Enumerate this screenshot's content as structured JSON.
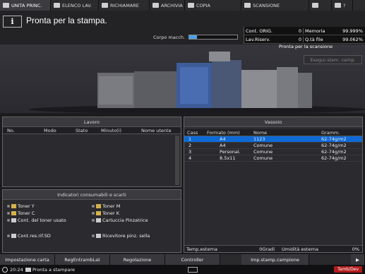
{
  "tabs": [
    {
      "label": "UNITA PRINC.",
      "icon": "home-icon"
    },
    {
      "label": "ELENCO LAV.",
      "icon": "job-list-icon"
    },
    {
      "label": "RICHIAMARE",
      "icon": "recall-icon"
    },
    {
      "label": "ARCHIVIA",
      "icon": "store-icon"
    },
    {
      "label": "COPIA",
      "icon": "copy-icon"
    },
    {
      "label": "SCANSIONE",
      "icon": "scan-icon"
    },
    {
      "label": "",
      "icon": "web-icon"
    },
    {
      "label": "?",
      "icon": "help-icon"
    }
  ],
  "header": {
    "info_glyph": "i",
    "status_message": "Pronta per la stampa.",
    "corpo_label": "Corpo macch.",
    "corpo_level": 0.15
  },
  "counters": {
    "cont_orig_label": "Cont. ORIG.",
    "cont_orig_value": "0",
    "memoria_label": "Memoria",
    "memoria_value": "99.999%",
    "lav_riserv_label": "Lav.Riserv.",
    "lav_riserv_value": "0",
    "qta_file_label": "Q.tà file",
    "qta_file_value": "99.062%"
  },
  "scan": {
    "status": "Pronta per la scansione",
    "button": "Esegui stam. camp."
  },
  "lavoro": {
    "title": "Lavoro",
    "columns": [
      "No.",
      "Modo",
      "Stato",
      "Minuto(i)",
      "Nome utente"
    ]
  },
  "consumabili": {
    "title": "Indicatori consumabili e scarti",
    "items": [
      {
        "label": "Toner Y",
        "color": "#d6b24a"
      },
      {
        "label": "Toner M",
        "color": "#d6b24a"
      },
      {
        "label": "Toner C",
        "color": "#d6b24a"
      },
      {
        "label": "Toner K",
        "color": "#d6b24a"
      },
      {
        "label": "Cont. del toner usato",
        "color": "#cccccc"
      },
      {
        "label": "Cartuccia Pinzatrice",
        "color": "#cccccc"
      },
      {
        "label": "Cont.res.rif.SD",
        "color": "#cccccc"
      },
      {
        "label": "Ricevitore pinz. sella",
        "color": "#cccccc"
      }
    ]
  },
  "vassoio": {
    "title": "Vassoio",
    "columns": [
      "Cass",
      "Formato (mm)",
      "Nome",
      "Gramm."
    ],
    "rows": [
      {
        "cass": "1",
        "formato": "A4",
        "nome": "1123",
        "gramm": "62-74g/m2",
        "selected": true
      },
      {
        "cass": "2",
        "formato": "A4",
        "nome": "Comune",
        "gramm": "62-74g/m2",
        "selected": false
      },
      {
        "cass": "3",
        "formato": "Personal.",
        "nome": "Comune",
        "gramm": "62-74g/m2",
        "selected": false
      },
      {
        "cass": "4",
        "formato": "8.5x11",
        "nome": "Comune",
        "gramm": "62-74g/m2",
        "selected": false
      }
    ],
    "temp_label": "Temp.esterna",
    "temp_value": "0Gradi",
    "umid_label": "Umidità esterna",
    "umid_value": "0%"
  },
  "bottom": [
    "Impostazione carta",
    "RegEntrambLat",
    "Regolazione",
    "Controller",
    "Imp.stamp.campione"
  ],
  "status": {
    "time": "20:24",
    "message": "Pronta a stampare",
    "mode": "Tamb/Dev"
  }
}
